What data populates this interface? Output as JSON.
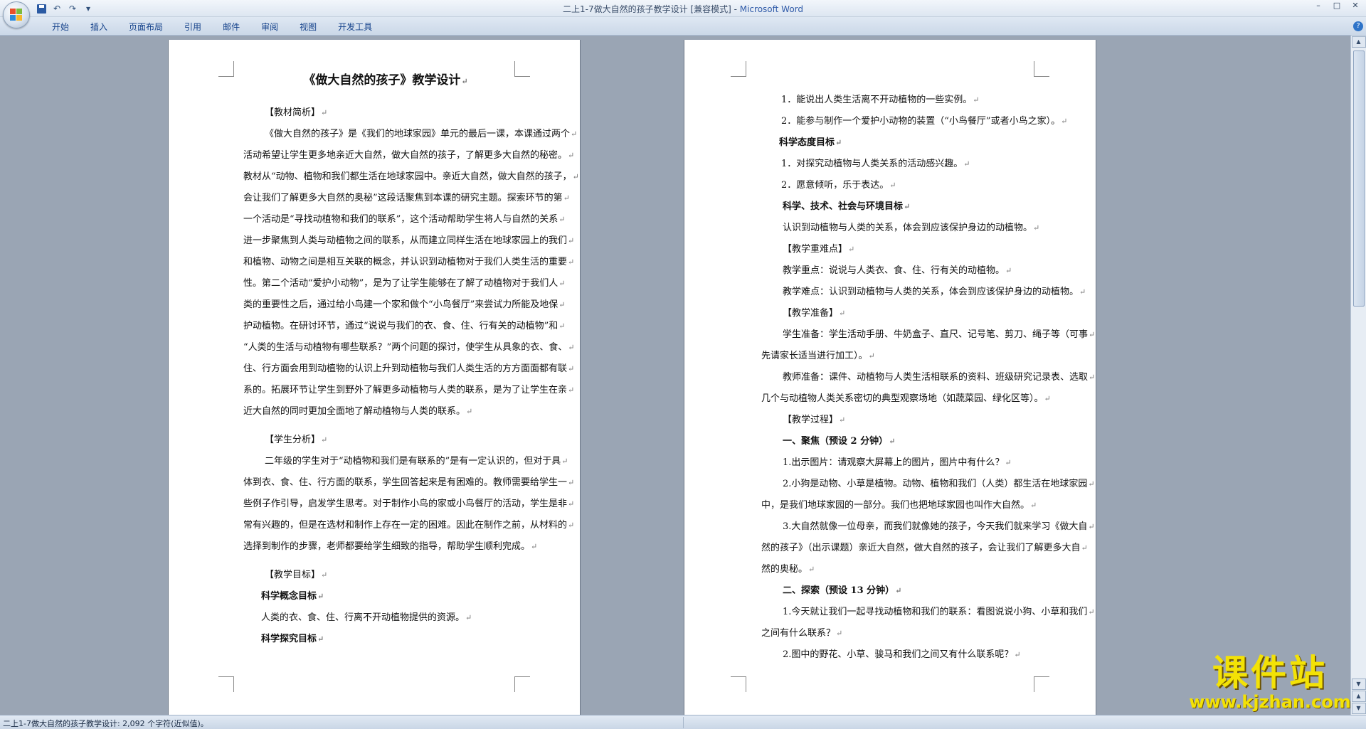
{
  "window": {
    "title_doc": "二上1-7做大自然的孩子教学设计 [兼容模式] - ",
    "title_app": "Microsoft Word",
    "controls": [
      "–",
      "□",
      "✕"
    ]
  },
  "quick_access": {
    "items": [
      "save-icon",
      "undo-icon",
      "redo-icon",
      "customize-icon"
    ],
    "undo_label": "↶",
    "redo_label": "↷",
    "more_label": "▾"
  },
  "ribbon": {
    "tabs": [
      "开始",
      "插入",
      "页面布局",
      "引用",
      "邮件",
      "审阅",
      "视图",
      "开发工具"
    ],
    "help_label": "?"
  },
  "document": {
    "left_page": {
      "title": "《做大自然的孩子》教学设计",
      "lines": [
        {
          "text": "【教材简析】",
          "indent": 30,
          "style": "normal"
        },
        {
          "text": "《做大自然的孩子》是《我们的地球家园》单元的最后一课，本课通过两个",
          "indent": 30,
          "style": "normal"
        },
        {
          "text": "活动希望让学生更多地亲近大自然，做大自然的孩子，了解更多大自然的秘密。",
          "indent": 0,
          "style": "normal"
        },
        {
          "text": "教材从“动物、植物和我们都生活在地球家园中。亲近大自然，做大自然的孩子，",
          "indent": 0,
          "style": "normal"
        },
        {
          "text": "会让我们了解更多大自然的奥秘”这段话聚焦到本课的研究主题。探索环节的第",
          "indent": 0,
          "style": "normal"
        },
        {
          "text": "一个活动是“寻找动植物和我们的联系”，这个活动帮助学生将人与自然的关系",
          "indent": 0,
          "style": "normal"
        },
        {
          "text": "进一步聚焦到人类与动植物之间的联系，从而建立同样生活在地球家园上的我们",
          "indent": 0,
          "style": "normal"
        },
        {
          "text": "和植物、动物之间是相互关联的概念，并认识到动植物对于我们人类生活的重要",
          "indent": 0,
          "style": "normal"
        },
        {
          "text": "性。第二个活动“爱护小动物”，是为了让学生能够在了解了动植物对于我们人",
          "indent": 0,
          "style": "normal"
        },
        {
          "text": "类的重要性之后，通过给小鸟建一个家和做个“小鸟餐厅”来尝试力所能及地保",
          "indent": 0,
          "style": "normal"
        },
        {
          "text": "护动植物。在研讨环节，通过“说说与我们的衣、食、住、行有关的动植物”和",
          "indent": 0,
          "style": "normal"
        },
        {
          "text": "“人类的生活与动植物有哪些联系？”两个问题的探讨，使学生从具象的衣、食、",
          "indent": 0,
          "style": "normal"
        },
        {
          "text": "住、行方面会用到动植物的认识上升到动植物与我们人类生活的方方面面都有联",
          "indent": 0,
          "style": "normal"
        },
        {
          "text": "系的。拓展环节让学生到野外了解更多动植物与人类的联系，是为了让学生在亲",
          "indent": 0,
          "style": "normal"
        },
        {
          "text": "近大自然的同时更加全面地了解动植物与人类的联系。",
          "indent": 0,
          "style": "normal"
        },
        {
          "text": "",
          "indent": 0,
          "style": "gap"
        },
        {
          "text": "【学生分析】",
          "indent": 30,
          "style": "normal"
        },
        {
          "text": "二年级的学生对于“动植物和我们是有联系的”是有一定认识的，但对于具",
          "indent": 30,
          "style": "normal"
        },
        {
          "text": "体到衣、食、住、行方面的联系，学生回答起来是有困难的。教师需要给学生一",
          "indent": 0,
          "style": "normal"
        },
        {
          "text": "些例子作引导，启发学生思考。对于制作小鸟的家或小鸟餐厅的活动，学生是非",
          "indent": 0,
          "style": "normal"
        },
        {
          "text": "常有兴趣的，但是在选材和制作上存在一定的困难。因此在制作之前，从材料的",
          "indent": 0,
          "style": "normal"
        },
        {
          "text": "选择到制作的步骤，老师都要给学生细致的指导，帮助学生顺利完成。",
          "indent": 0,
          "style": "normal"
        },
        {
          "text": "",
          "indent": 0,
          "style": "gap"
        },
        {
          "text": "【教学目标】",
          "indent": 30,
          "style": "normal"
        },
        {
          "text": "科学概念目标",
          "indent": 25,
          "style": "bold"
        },
        {
          "text": "人类的衣、食、住、行离不开动植物提供的资源。",
          "indent": 25,
          "style": "normal"
        },
        {
          "text": "科学探究目标",
          "indent": 25,
          "style": "bold"
        }
      ]
    },
    "right_page": {
      "lines": [
        {
          "text": "1．能说出人类生活离不开动植物的一些实例。",
          "indent": 28,
          "style": "normal"
        },
        {
          "text": "2．能参与制作一个爱护小动物的装置（“小鸟餐厅”或者小鸟之家）。",
          "indent": 28,
          "style": "normal"
        },
        {
          "text": "科学态度目标",
          "indent": 25,
          "style": "bold"
        },
        {
          "text": "1．对探究动植物与人类关系的活动感兴趣。",
          "indent": 28,
          "style": "normal"
        },
        {
          "text": "2．愿意倾听，乐于表达。",
          "indent": 28,
          "style": "normal"
        },
        {
          "text": "科学、技术、社会与环境目标",
          "indent": 30,
          "style": "bold"
        },
        {
          "text": "认识到动植物与人类的关系，体会到应该保护身边的动植物。",
          "indent": 30,
          "style": "normal"
        },
        {
          "text": "【教学重难点】",
          "indent": 30,
          "style": "normal"
        },
        {
          "text": "教学重点：说说与人类衣、食、住、行有关的动植物。",
          "indent": 30,
          "style": "normal"
        },
        {
          "text": "教学难点：认识到动植物与人类的关系，体会到应该保护身边的动植物。",
          "indent": 30,
          "style": "normal"
        },
        {
          "text": "【教学准备】",
          "indent": 30,
          "style": "normal"
        },
        {
          "text": "学生准备：学生活动手册、牛奶盒子、直尺、记号笔、剪刀、绳子等（可事",
          "indent": 30,
          "style": "normal"
        },
        {
          "text": "先请家长适当进行加工）。",
          "indent": 0,
          "style": "normal"
        },
        {
          "text": "教师准备：课件、动植物与人类生活相联系的资料、班级研究记录表、选取",
          "indent": 30,
          "style": "normal"
        },
        {
          "text": "几个与动植物人类关系密切的典型观察场地（如蔬菜园、绿化区等）。",
          "indent": 0,
          "style": "normal"
        },
        {
          "text": "【教学过程】",
          "indent": 30,
          "style": "normal"
        },
        {
          "text": "一、聚焦（预设 2 分钟）",
          "indent": 30,
          "style": "bold"
        },
        {
          "text": "1.出示图片：请观察大屏幕上的图片，图片中有什么？",
          "indent": 30,
          "style": "normal"
        },
        {
          "text": "2.小狗是动物、小草是植物。动物、植物和我们（人类）都生活在地球家园",
          "indent": 30,
          "style": "normal"
        },
        {
          "text": "中，是我们地球家园的一部分。我们也把地球家园也叫作大自然。",
          "indent": 0,
          "style": "normal"
        },
        {
          "text": "3.大自然就像一位母亲，而我们就像她的孩子，今天我们就来学习《做大自",
          "indent": 30,
          "style": "normal"
        },
        {
          "text": "然的孩子》（出示课题）亲近大自然，做大自然的孩子，会让我们了解更多大自",
          "indent": 0,
          "style": "normal"
        },
        {
          "text": "然的奥秘。",
          "indent": 0,
          "style": "normal"
        },
        {
          "text": "二、探索（预设 13 分钟）",
          "indent": 30,
          "style": "bold"
        },
        {
          "text": "1.今天就让我们一起寻找动植物和我们的联系：看图说说小狗、小草和我们",
          "indent": 30,
          "style": "normal"
        },
        {
          "text": "之间有什么联系？",
          "indent": 0,
          "style": "normal"
        },
        {
          "text": "2.图中的野花、小草、骏马和我们之间又有什么联系呢？",
          "indent": 30,
          "style": "normal"
        }
      ]
    },
    "paragraph_mark": "↵"
  },
  "scrollbar": {
    "up_label": "▲",
    "down_label": "▼",
    "prev_label": "▲",
    "next_label": "▼"
  },
  "status_bar": {
    "text": "二上1-7做大自然的孩子教学设计: 2,092 个字符(近似值)。"
  },
  "watermark": {
    "name": "课件站",
    "url": "www.kjzhan.com"
  }
}
